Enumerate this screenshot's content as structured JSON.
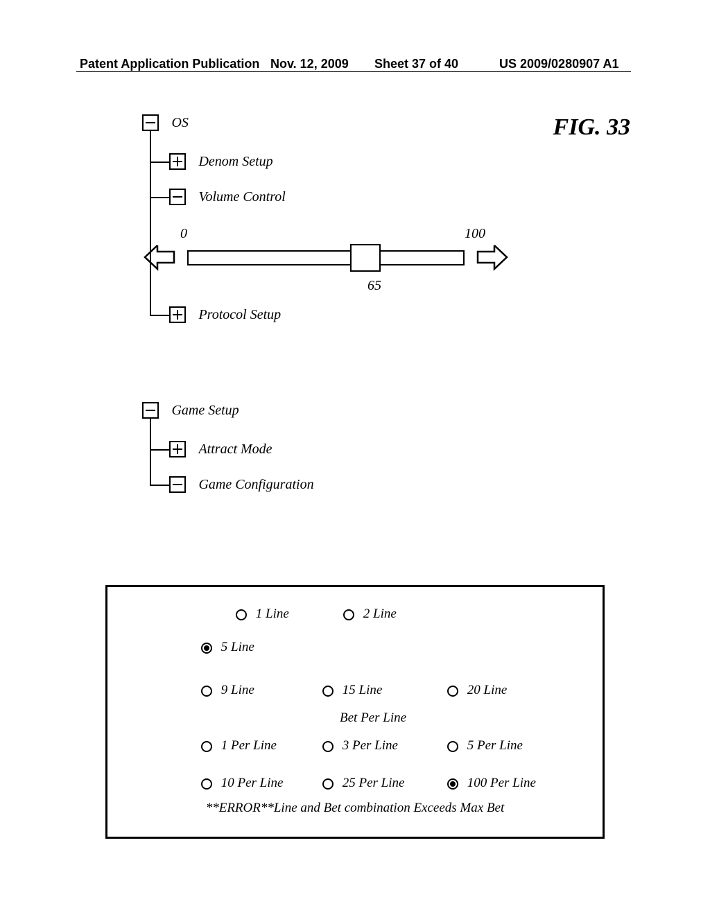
{
  "header": {
    "left": "Patent Application Publication",
    "date": "Nov. 12, 2009",
    "sheet": "Sheet 37 of 40",
    "pubno": "US 2009/0280907 A1"
  },
  "figure_label": "FIG. 33",
  "tree1": {
    "root": "OS",
    "items": {
      "denom": "Denom Setup",
      "volume": "Volume Control",
      "protocol": "Protocol Setup"
    }
  },
  "slider": {
    "min": "0",
    "max": "100",
    "value": "65"
  },
  "tree2": {
    "root": "Game Setup",
    "items": {
      "attract": "Attract Mode",
      "gameconfig": "Game Configuration"
    }
  },
  "panel": {
    "lines": {
      "l1": "1 Line",
      "l2": "2 Line",
      "l5": "5 Line",
      "l9": "9 Line",
      "l15": "15 Line",
      "l20": "20 Line"
    },
    "betlabel": "Bet Per Line",
    "bets": {
      "b1": "1 Per Line",
      "b3": "3 Per Line",
      "b5": "5 Per Line",
      "b10": "10 Per Line",
      "b25": "25 Per Line",
      "b100": "100 Per Line"
    },
    "error": "**ERROR**Line and Bet combination Exceeds Max Bet"
  }
}
